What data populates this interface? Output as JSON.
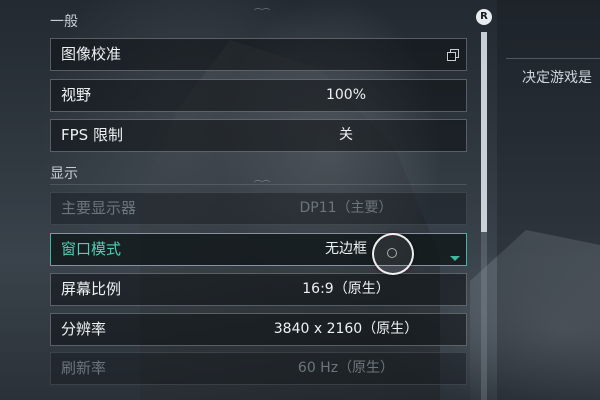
{
  "sections": {
    "general": {
      "title": "一般"
    },
    "display": {
      "title": "显示"
    }
  },
  "settings": {
    "image_calibration": {
      "label": "图像校准",
      "icon": "copy-icon"
    },
    "fov": {
      "label": "视野",
      "value": "100%"
    },
    "fps_limit": {
      "label": "FPS 限制",
      "value": "关"
    },
    "main_display": {
      "label": "主要显示器",
      "value": "DP11（主要）",
      "state": "disabled"
    },
    "window_mode": {
      "label": "窗口模式",
      "value": "无边框",
      "state": "selected",
      "icon": "dropdown-icon"
    },
    "aspect_ratio": {
      "label": "屏幕比例",
      "value": "16:9（原生）"
    },
    "resolution": {
      "label": "分辨率",
      "value": "3840 x 2160（原生）"
    },
    "refresh_rate": {
      "label": "刷新率",
      "value": "60 Hz（原生）",
      "state": "disabled"
    }
  },
  "scroll": {
    "button_label": "R"
  },
  "description": {
    "text": "决定游戏是"
  },
  "colors": {
    "accent": "#3fb6a0",
    "accent_text": "#4fd0b4",
    "text": "#eef1f3",
    "disabled_text": "#6d757c"
  }
}
